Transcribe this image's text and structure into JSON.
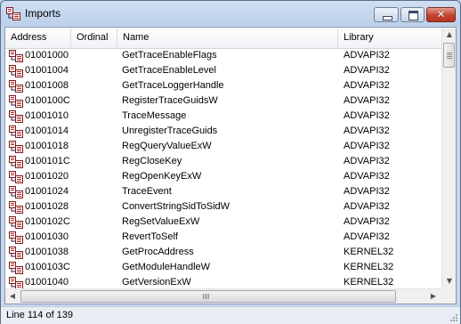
{
  "window": {
    "title": "Imports"
  },
  "columns": {
    "address": "Address",
    "ordinal": "Ordinal",
    "name": "Name",
    "library": "Library"
  },
  "rows": [
    {
      "address": "01001000",
      "ordinal": "",
      "name": "GetTraceEnableFlags",
      "library": "ADVAPI32"
    },
    {
      "address": "01001004",
      "ordinal": "",
      "name": "GetTraceEnableLevel",
      "library": "ADVAPI32"
    },
    {
      "address": "01001008",
      "ordinal": "",
      "name": "GetTraceLoggerHandle",
      "library": "ADVAPI32"
    },
    {
      "address": "0100100C",
      "ordinal": "",
      "name": "RegisterTraceGuidsW",
      "library": "ADVAPI32"
    },
    {
      "address": "01001010",
      "ordinal": "",
      "name": "TraceMessage",
      "library": "ADVAPI32"
    },
    {
      "address": "01001014",
      "ordinal": "",
      "name": "UnregisterTraceGuids",
      "library": "ADVAPI32"
    },
    {
      "address": "01001018",
      "ordinal": "",
      "name": "RegQueryValueExW",
      "library": "ADVAPI32"
    },
    {
      "address": "0100101C",
      "ordinal": "",
      "name": "RegCloseKey",
      "library": "ADVAPI32"
    },
    {
      "address": "01001020",
      "ordinal": "",
      "name": "RegOpenKeyExW",
      "library": "ADVAPI32"
    },
    {
      "address": "01001024",
      "ordinal": "",
      "name": "TraceEvent",
      "library": "ADVAPI32"
    },
    {
      "address": "01001028",
      "ordinal": "",
      "name": "ConvertStringSidToSidW",
      "library": "ADVAPI32"
    },
    {
      "address": "0100102C",
      "ordinal": "",
      "name": "RegSetValueExW",
      "library": "ADVAPI32"
    },
    {
      "address": "01001030",
      "ordinal": "",
      "name": "RevertToSelf",
      "library": "ADVAPI32"
    },
    {
      "address": "01001038",
      "ordinal": "",
      "name": "GetProcAddress",
      "library": "KERNEL32"
    },
    {
      "address": "0100103C",
      "ordinal": "",
      "name": "GetModuleHandleW",
      "library": "KERNEL32"
    },
    {
      "address": "01001040",
      "ordinal": "",
      "name": "GetVersionExW",
      "library": "KERNEL32"
    }
  ],
  "status": {
    "text": "Line 114 of 139"
  },
  "icons": {
    "app": "imports-icon",
    "row": "import-entry-icon"
  }
}
